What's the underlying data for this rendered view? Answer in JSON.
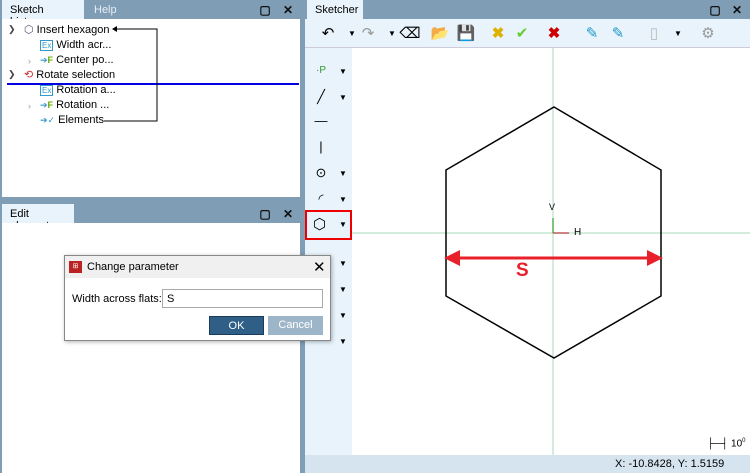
{
  "sketch_history": {
    "tabs": [
      "Sketch history",
      "Help"
    ],
    "items": [
      {
        "label": "Insert hexagon",
        "icon": "hexagon-icon",
        "expanded": true
      },
      {
        "label": "Width acr...",
        "icon": "expression-icon"
      },
      {
        "label": "Center po...",
        "icon": "point-reference-icon",
        "collapsed": true
      },
      {
        "label": "Rotate selection",
        "icon": "rotate-icon",
        "expanded": true
      },
      {
        "label": "Rotation a...",
        "icon": "expression-icon"
      },
      {
        "label": "Rotation ...",
        "icon": "point-reference-icon",
        "collapsed": true
      },
      {
        "label": "Elements",
        "icon": "elements-icon"
      }
    ]
  },
  "edit_element": {
    "title": "Edit element"
  },
  "dialog": {
    "title": "Change parameter",
    "field_label": "Width across flats:",
    "field_value": "S",
    "ok": "OK",
    "cancel": "Cancel"
  },
  "sketcher": {
    "tab": "Sketcher",
    "dimension_label": "S",
    "axis_h": "H",
    "axis_v": "V",
    "scale_label": "10",
    "scale_sup": "0",
    "coords": "X: -10.8428, Y: 1.5159"
  },
  "colors": {
    "header": "#7f9db5",
    "panel": "#e8f3fb",
    "dimension": "#e8202a",
    "selection_line": "#0000e0",
    "axis": "#a8d8b8",
    "ok_button": "#2f5f86",
    "cancel_button": "#9db5c8"
  }
}
